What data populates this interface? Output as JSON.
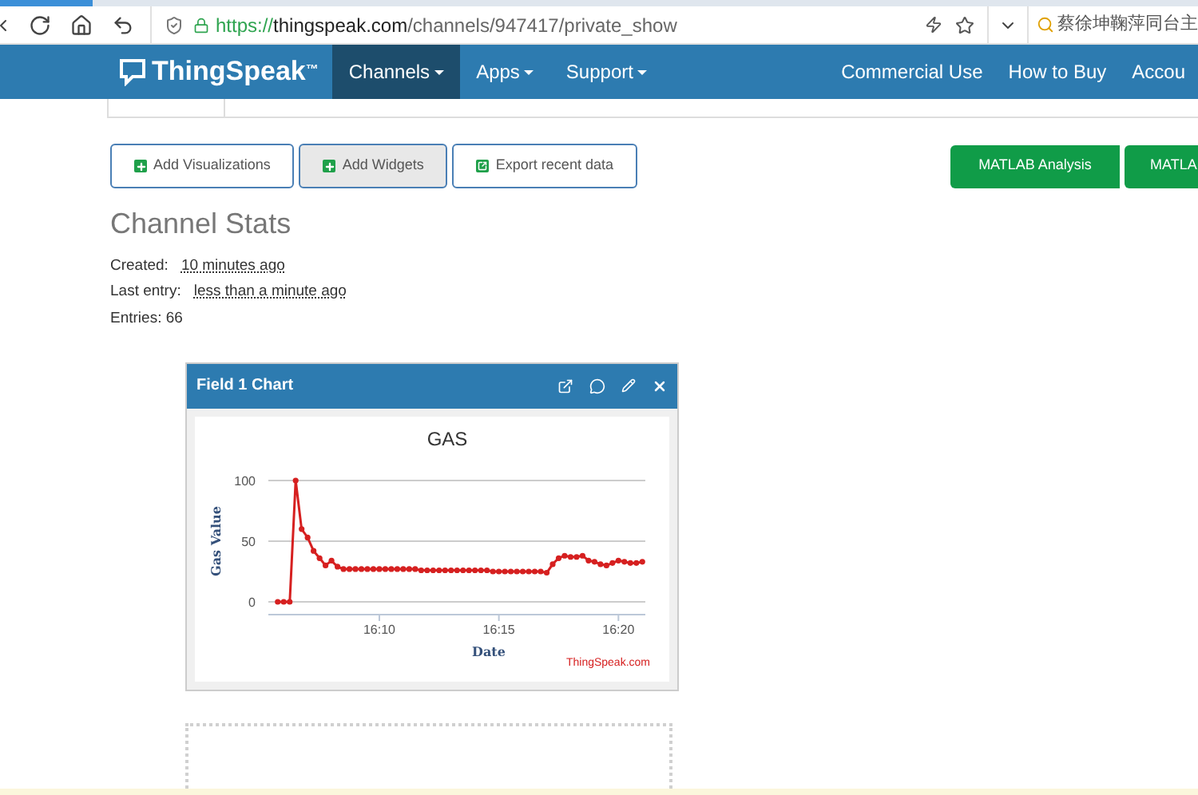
{
  "browser": {
    "url_scheme": "https://",
    "url_domain": "thingspeak.com",
    "url_path": "/channels/947417/private_show",
    "search_text": "蔡徐坤鞠萍同台主"
  },
  "nav": {
    "logo": "ThingSpeak",
    "logo_mark": "™",
    "items": [
      {
        "label": "Channels",
        "dropdown": true,
        "selected": true
      },
      {
        "label": "Apps",
        "dropdown": true,
        "selected": false
      },
      {
        "label": "Support",
        "dropdown": true,
        "selected": false
      }
    ],
    "right_items": [
      "Commercial Use",
      "How to Buy",
      "Accou"
    ]
  },
  "toolbar": {
    "buttons": [
      {
        "label": "Add Visualizations",
        "kind": "plus",
        "selected": false
      },
      {
        "label": "Add Widgets",
        "kind": "plus",
        "selected": true
      },
      {
        "label": "Export recent data",
        "kind": "export",
        "selected": false
      }
    ],
    "right_buttons": [
      "MATLAB Analysis",
      "MATLA"
    ]
  },
  "stats": {
    "title": "Channel Stats",
    "rows": [
      {
        "label": "Created:",
        "value": "10 minutes ago"
      },
      {
        "label": "Last entry:",
        "value": "less than a minute ago"
      },
      {
        "label": "Entries: 66"
      }
    ]
  },
  "widget": {
    "title": "Field 1 Chart",
    "credit": "ThingSpeak.com",
    "chart_data": {
      "type": "line",
      "title": "GAS",
      "xlabel": "Date",
      "ylabel": "Gas Value",
      "categories": [
        null,
        null,
        null,
        null,
        null,
        null,
        null,
        null,
        null,
        null,
        null,
        null,
        null,
        null,
        null,
        null,
        null,
        "16:10",
        null,
        null,
        null,
        null,
        null,
        null,
        null,
        null,
        null,
        null,
        null,
        null,
        null,
        null,
        null,
        null,
        null,
        null,
        null,
        "16:15",
        null,
        null,
        null,
        null,
        null,
        null,
        null,
        null,
        null,
        null,
        null,
        null,
        null,
        null,
        null,
        null,
        null,
        null,
        null,
        "16:20",
        null,
        null,
        null,
        null
      ],
      "series": [
        {
          "color": "#d62020",
          "marker": true,
          "values": [
            0,
            0,
            0,
            100,
            60,
            53,
            42,
            36,
            30,
            34,
            29,
            27,
            27,
            27,
            27,
            27,
            27,
            27,
            27,
            27,
            27,
            27,
            27,
            27,
            26,
            26,
            26,
            26,
            26,
            26,
            26,
            26,
            26,
            26,
            26,
            26,
            25,
            25,
            25,
            25,
            25,
            25,
            25,
            25,
            25,
            24,
            31,
            36,
            38,
            37,
            37,
            38,
            34,
            33,
            31,
            30,
            32,
            34,
            33,
            32,
            32,
            33
          ]
        }
      ],
      "grid": true,
      "ylim": [
        0,
        100
      ],
      "yticks": [
        0,
        50,
        100
      ]
    }
  }
}
